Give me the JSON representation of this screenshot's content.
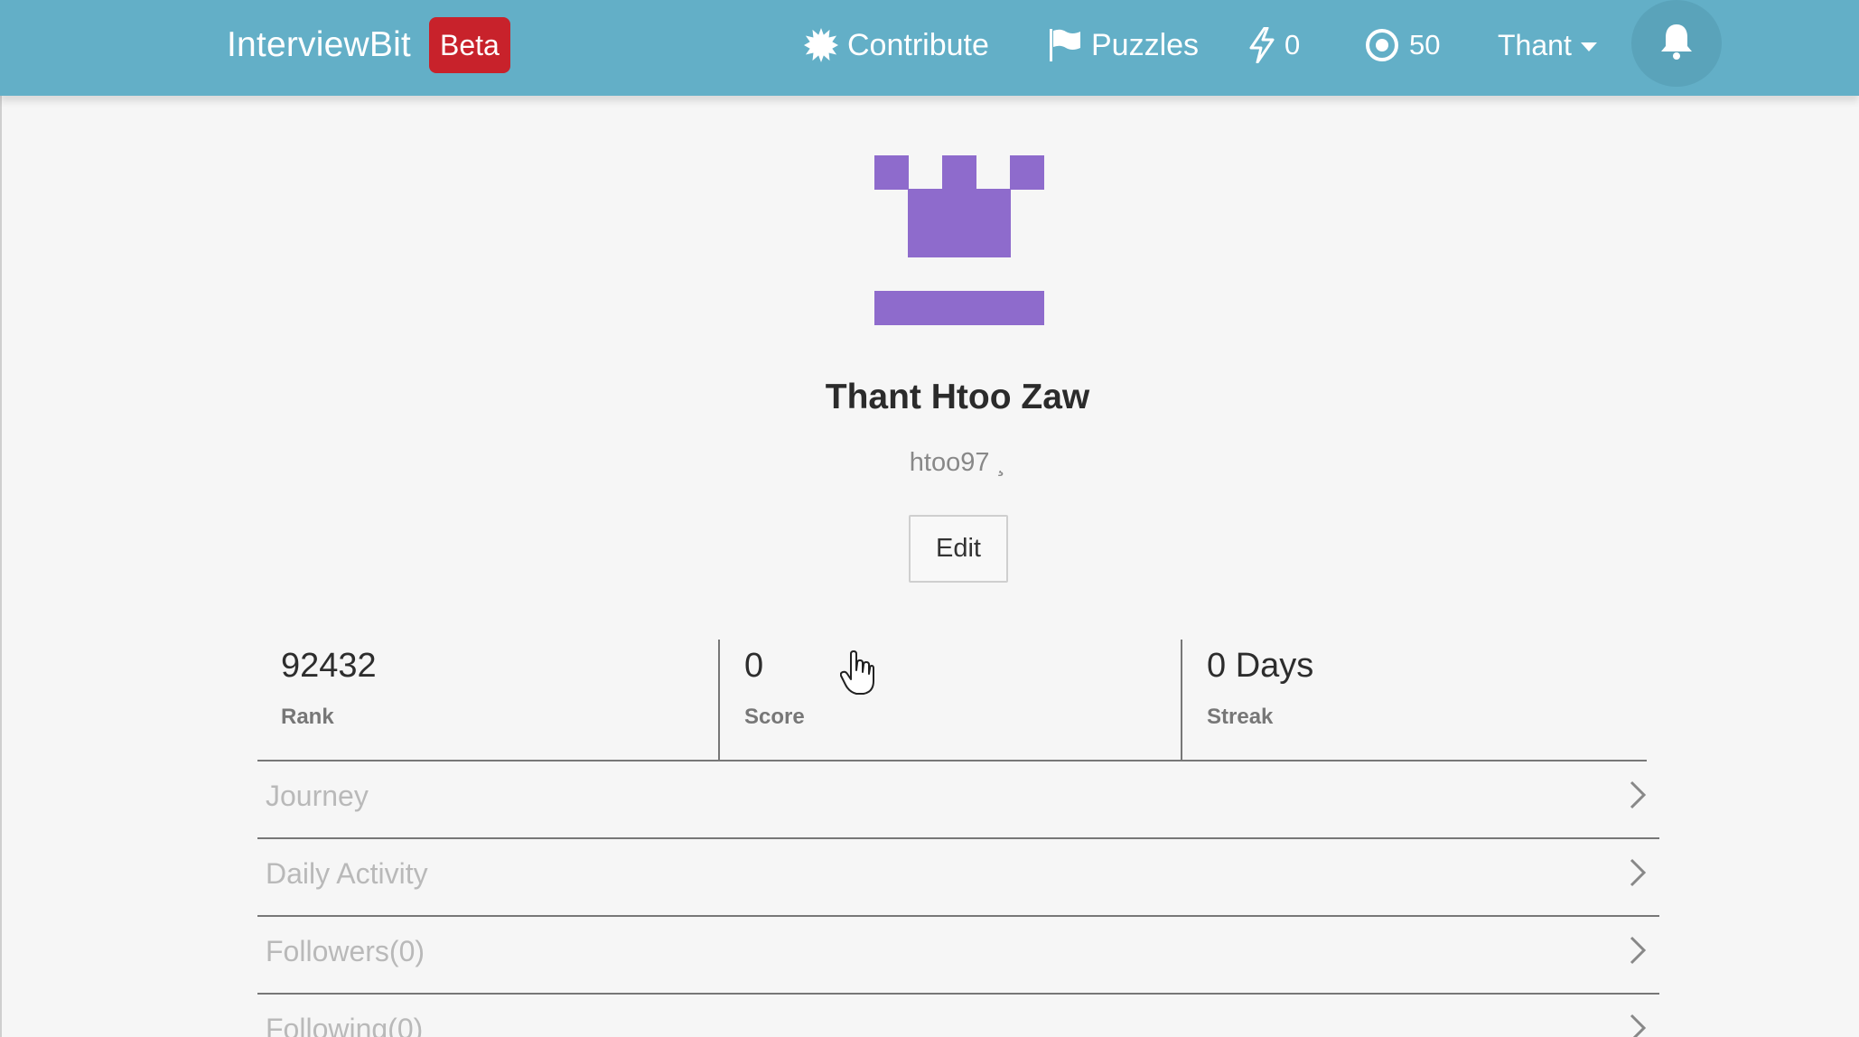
{
  "navbar": {
    "brand": "InterviewBit",
    "badge": "Beta",
    "contribute": "Contribute",
    "puzzles": "Puzzles",
    "streak_count": "0",
    "coins": "50",
    "user": "Thant",
    "icons": [
      "contribute-icon",
      "flag-icon",
      "bolt-icon",
      "target-icon",
      "bell-icon"
    ],
    "colors": {
      "bar": "#63afc7",
      "badge": "#c8222b"
    }
  },
  "profile": {
    "name": "Thant Htoo Zaw",
    "handle": "htoo97 ¸",
    "edit_label": "Edit",
    "avatar_color": "#8e6bcc"
  },
  "stats": {
    "rank_value": "92432",
    "rank_label": "Rank",
    "score_value": "0",
    "score_label": "Score",
    "streak_value": "0 Days",
    "streak_label": "Streak"
  },
  "sections": [
    {
      "label": "Journey"
    },
    {
      "label": "Daily Activity"
    },
    {
      "label": "Followers(0)"
    },
    {
      "label": "Following(0)"
    }
  ]
}
